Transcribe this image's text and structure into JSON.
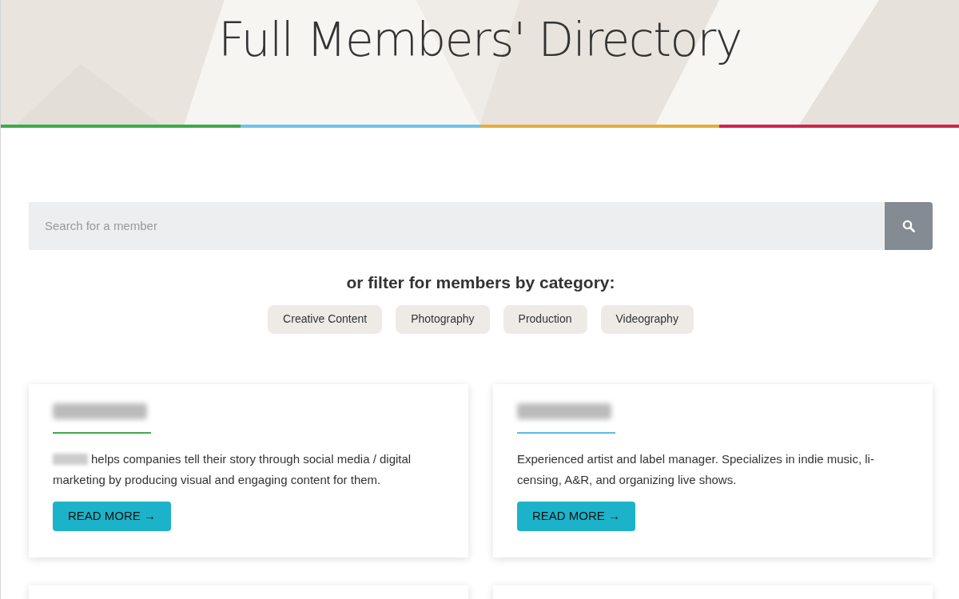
{
  "header": {
    "title": "Full Members' Directory",
    "stripes": [
      {
        "color": "#3daa4a"
      },
      {
        "color": "#6ec3e8"
      },
      {
        "color": "#e3ad3d"
      },
      {
        "color": "#d0244f"
      }
    ]
  },
  "search": {
    "placeholder": "Search for a member"
  },
  "filter": {
    "heading": "or filter for members by category:",
    "categories": [
      "Creative Content",
      "Photography",
      "Production",
      "Videography"
    ]
  },
  "members": [
    {
      "color": "#3daa4a",
      "name_redacted": true,
      "description": "helps companies tell their story through social media / digital marketing by producing visual and engaging content for them.",
      "subject_redacted": true,
      "button": "READ MORE →"
    },
    {
      "color": "#5bbbe6",
      "name_redacted": true,
      "description": "Experienced artist and label manager. Specializes in indie music, li-censing, A&R, and organizing live shows.",
      "subject_redacted": false,
      "button": "READ MORE →"
    }
  ]
}
